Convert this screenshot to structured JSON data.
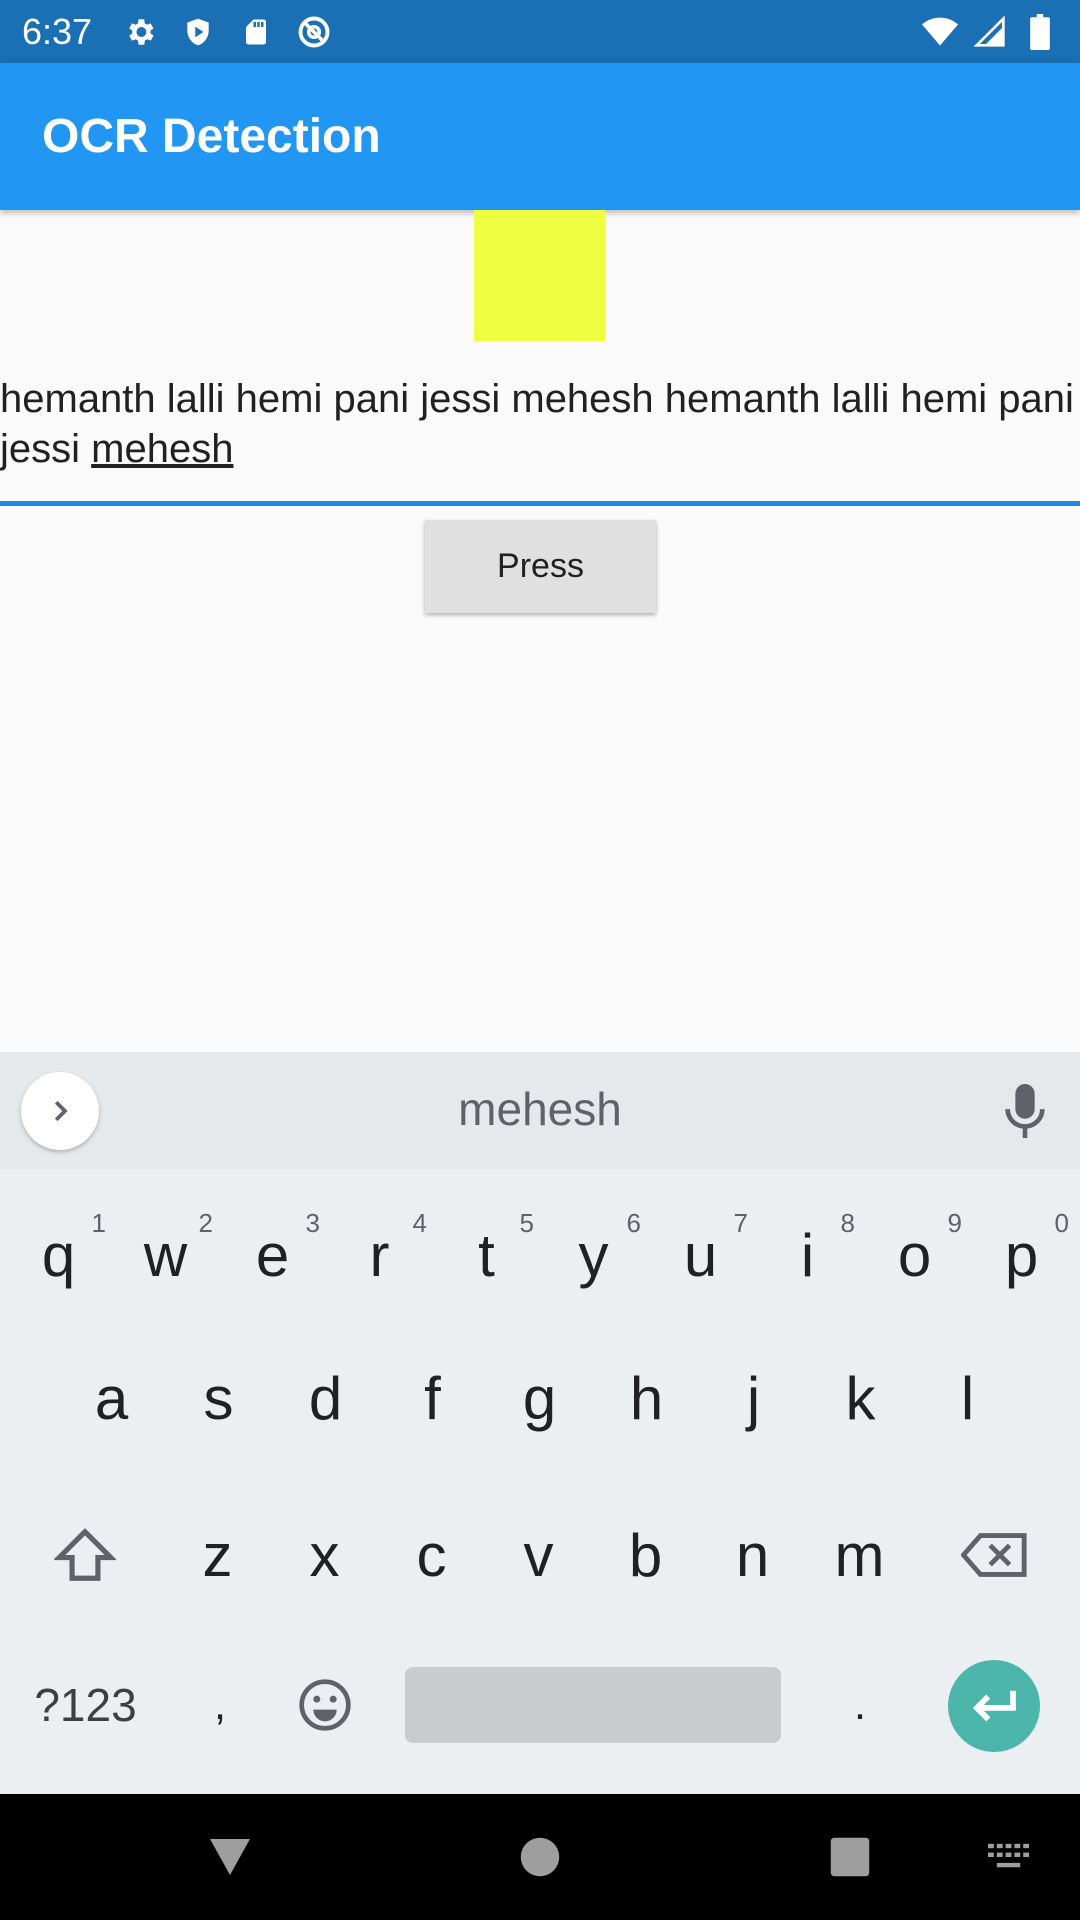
{
  "status_bar": {
    "time": "6:37",
    "icons_left": [
      "settings-icon",
      "play-protect-icon",
      "sd-card-icon",
      "vpn-icon"
    ],
    "icons_right": [
      "wifi-icon",
      "signal-icon",
      "battery-icon"
    ]
  },
  "app_bar": {
    "title": "OCR Detection"
  },
  "text_field": {
    "text_before_composing": "hemanth lalli hemi pani jessi mehesh hemanth lalli hemi pani jessi ",
    "composing_word": "mehesh"
  },
  "press_button": {
    "label": "Press"
  },
  "keyboard": {
    "suggestion": "mehesh",
    "row1": [
      {
        "key": "q",
        "hint": "1"
      },
      {
        "key": "w",
        "hint": "2"
      },
      {
        "key": "e",
        "hint": "3"
      },
      {
        "key": "r",
        "hint": "4"
      },
      {
        "key": "t",
        "hint": "5"
      },
      {
        "key": "y",
        "hint": "6"
      },
      {
        "key": "u",
        "hint": "7"
      },
      {
        "key": "i",
        "hint": "8"
      },
      {
        "key": "o",
        "hint": "9"
      },
      {
        "key": "p",
        "hint": "0"
      }
    ],
    "row2": [
      "a",
      "s",
      "d",
      "f",
      "g",
      "h",
      "j",
      "k",
      "l"
    ],
    "row3": [
      "z",
      "x",
      "c",
      "v",
      "b",
      "n",
      "m"
    ],
    "symbols_key": "?123",
    "comma_key": ",",
    "period_key": ".",
    "enter_color": "#4db6ac"
  },
  "colors": {
    "status_bar": "#1a6fb5",
    "app_bar": "#2196f3",
    "yellow_box": "#eeff41",
    "underline": "#1e88e5"
  }
}
